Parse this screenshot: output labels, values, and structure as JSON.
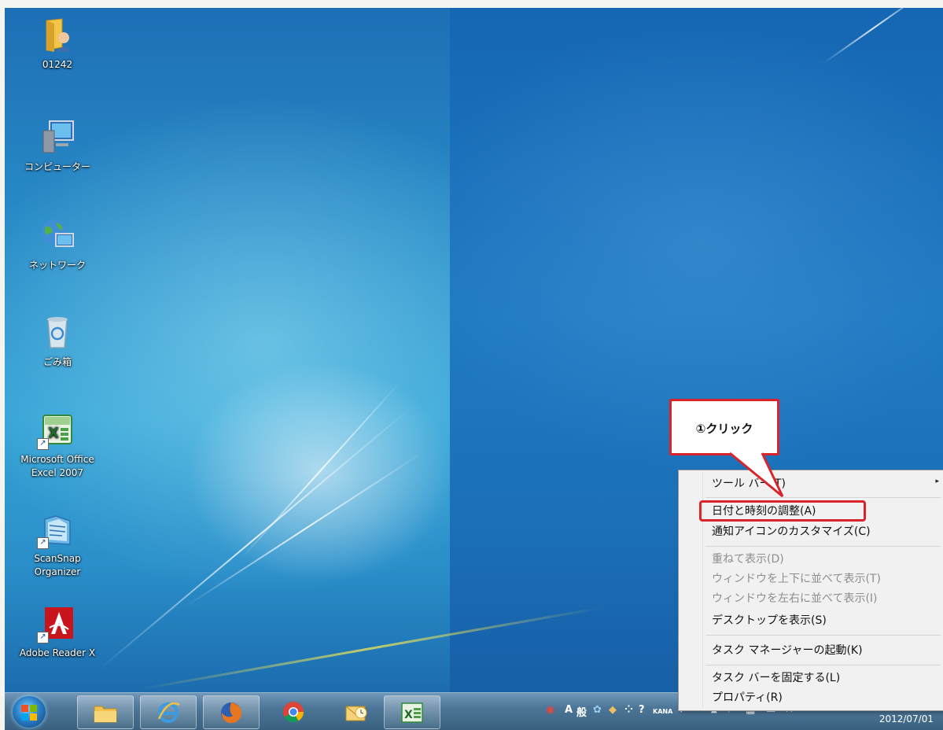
{
  "desktop": {
    "icons": [
      {
        "name": "user-folder",
        "label": "01242",
        "icon": "folder-user-icon"
      },
      {
        "name": "computer",
        "label": "コンピューター",
        "icon": "computer-icon"
      },
      {
        "name": "network",
        "label": "ネットワーク",
        "icon": "network-icon"
      },
      {
        "name": "recycle-bin",
        "label": "ごみ箱",
        "icon": "recycle-bin-icon"
      },
      {
        "name": "excel-2007",
        "label": "Microsoft Office\nExcel 2007",
        "icon": "excel-icon"
      },
      {
        "name": "scansnap-organizer",
        "label": "ScanSnap\nOrganizer",
        "icon": "scansnap-icon"
      },
      {
        "name": "adobe-reader",
        "label": "Adobe Reader X",
        "icon": "adobe-reader-icon"
      }
    ]
  },
  "taskbar": {
    "pinned": [
      "explorer-icon",
      "internet-explorer-icon",
      "firefox-icon",
      "chrome-icon",
      "outlook-icon",
      "excel-icon"
    ],
    "tray": {
      "ime_mode": "A",
      "ime_dict": "般",
      "kana_label": "KANA",
      "date": "2012/07/01"
    }
  },
  "context_menu": {
    "items": [
      {
        "label": "ツール バー(T)",
        "enabled": true,
        "submenu": true
      },
      {
        "label": "日付と時刻の調整(A)",
        "enabled": true,
        "highlighted": true
      },
      {
        "label": "通知アイコンのカスタマイズ(C)",
        "enabled": true
      },
      {
        "label": "重ねて表示(D)",
        "enabled": false
      },
      {
        "label": "ウィンドウを上下に並べて表示(T)",
        "enabled": false
      },
      {
        "label": "ウィンドウを左右に並べて表示(I)",
        "enabled": false
      },
      {
        "label": "デスクトップを表示(S)",
        "enabled": true
      },
      {
        "label": "タスク マネージャーの起動(K)",
        "enabled": true
      },
      {
        "label": "タスク バーを固定する(L)",
        "enabled": true
      },
      {
        "label": "プロパティ(R)",
        "enabled": true
      }
    ],
    "submenu_arrow": "▸"
  },
  "callout": {
    "text": "①クリック",
    "color": "#d8242a"
  }
}
